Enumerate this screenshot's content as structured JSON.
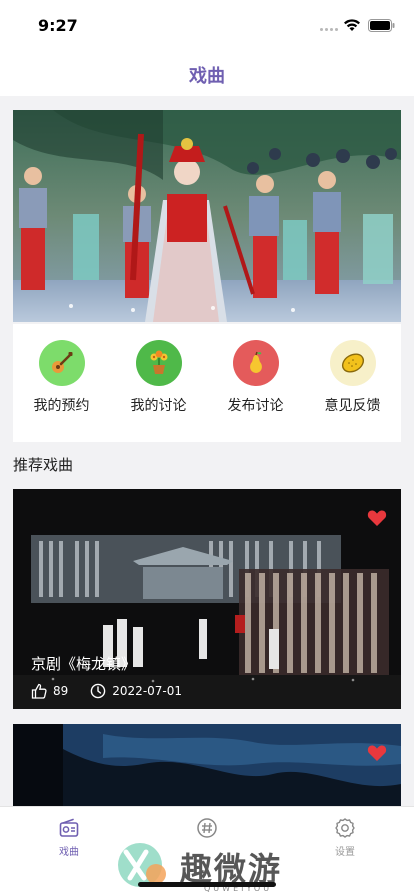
{
  "status_bar": {
    "time": "9:27"
  },
  "nav": {
    "title": "戏曲"
  },
  "quick_actions": [
    {
      "label": "我的预约",
      "icon": "guitar-icon",
      "bg": "#7ddc6b"
    },
    {
      "label": "我的讨论",
      "icon": "flower-pot-icon",
      "bg": "#4fb949"
    },
    {
      "label": "发布讨论",
      "icon": "pear-icon",
      "bg": "#e45b5b"
    },
    {
      "label": "意见反馈",
      "icon": "lemon-icon",
      "bg": "#f7f0c9"
    }
  ],
  "section": {
    "title": "推荐戏曲"
  },
  "cards": [
    {
      "title": "京剧《梅龙镇》",
      "likes": "89",
      "date": "2022-07-01",
      "favorited": true
    },
    {
      "title": "",
      "likes": "",
      "date": "",
      "favorited": true
    }
  ],
  "tabs": [
    {
      "label": "戏曲",
      "icon": "radio-icon",
      "active": true
    },
    {
      "label": "",
      "icon": "hashtag-icon",
      "active": false
    },
    {
      "label": "设置",
      "icon": "gear-icon",
      "active": false
    }
  ],
  "watermark": {
    "text": "趣微游",
    "sub": "QUWEIYOU"
  },
  "colors": {
    "accent": "#6f5fb1",
    "heart": "#e8383d"
  }
}
